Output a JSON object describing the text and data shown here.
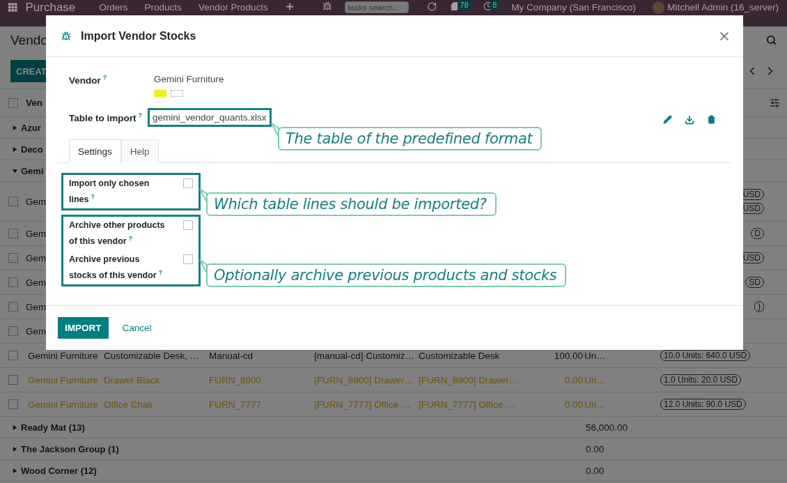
{
  "navbar": {
    "app": "Purchase",
    "menu": [
      "Orders",
      "Products",
      "Vendor Products"
    ],
    "search": {
      "placeholder": "tasks search..."
    },
    "messages_count": "78",
    "activities_count": "8",
    "company": "My Company (San Francisco)",
    "user": "Mitchell Admin (16_server)"
  },
  "control_panel": {
    "title": "Vendo",
    "create_button": "CREAT"
  },
  "list": {
    "header": "Ven",
    "select_all_checked": false,
    "rows": [
      {
        "kind": "group",
        "label": "Azur",
        "expanded": false
      },
      {
        "kind": "group",
        "label": "Deco",
        "expanded": false
      },
      {
        "kind": "group",
        "label": "Gemi",
        "expanded": true
      },
      {
        "kind": "clipped",
        "checked": false,
        "cells": [
          "Gem"
        ],
        "badges": [
          "USD",
          "USD"
        ]
      },
      {
        "kind": "clipped",
        "checked": false,
        "cells": [
          "Gem"
        ],
        "badges": [
          "D"
        ]
      },
      {
        "kind": "clipped",
        "checked": false,
        "cells": [
          "Gem"
        ],
        "badges": [
          "USD"
        ]
      },
      {
        "kind": "clipped",
        "checked": false,
        "cells": [
          "Gem"
        ],
        "badges": [
          "SD"
        ]
      },
      {
        "kind": "clipped",
        "checked": false,
        "cells": [
          "Gem"
        ],
        "badges": [
          ")"
        ]
      },
      {
        "kind": "clipped",
        "checked": false,
        "cells": [
          "Gem"
        ],
        "badges": []
      },
      {
        "kind": "record",
        "checked": false,
        "warning": false,
        "cells": [
          "Gemini Furniture",
          "Customizable Desk, …",
          "Manual-cd",
          "[manual-cd] Customiz…",
          "Customizable Desk",
          "100.00",
          "Un…"
        ],
        "badges": [
          "10.0 Units: 640.0 USD"
        ]
      },
      {
        "kind": "record",
        "checked": false,
        "warning": true,
        "cells": [
          "Gemini Furniture",
          "Drawer Black",
          "FURN_8900",
          "[FURN_8900] Drawer…",
          "[FURN_8900] Drawer…",
          "0.00",
          "Un…"
        ],
        "badges": [
          "1.0 Units: 20.0 USD"
        ]
      },
      {
        "kind": "record",
        "checked": false,
        "warning": true,
        "cells": [
          "Gemini Furniture",
          "Office Chair",
          "FURN_7777",
          "[FURN_7777] Office …",
          "[FURN_7777] Office …",
          "0.00",
          "Un…"
        ],
        "badges": [
          "12.0 Units: 90.0 USD"
        ]
      },
      {
        "kind": "group",
        "label": "Ready Mat (13)",
        "expanded": false,
        "total": "56,000.00"
      },
      {
        "kind": "group",
        "label": "The Jackson Group (1)",
        "expanded": false,
        "total": "0.00"
      },
      {
        "kind": "group",
        "label": "Wood Corner (12)",
        "expanded": false,
        "total": "0.00"
      }
    ]
  },
  "dialog": {
    "title": "Import Vendor Stocks",
    "vendor": {
      "label": "Vendor",
      "help": "?",
      "value": "Gemini Furniture",
      "tags": [
        {
          "color": "#f0f020"
        },
        {
          "color": "#ffffff"
        }
      ]
    },
    "table": {
      "label": "Table to import",
      "help": "?",
      "value": "gemini_vendor_quants.xlsx"
    },
    "tabs": [
      {
        "label": "Settings",
        "selected": true
      },
      {
        "label": "Help",
        "selected": false
      }
    ],
    "option_groups": [
      [
        {
          "label": "Import only chosen lines",
          "help": "?",
          "checked": false
        }
      ],
      [
        {
          "label": "Archive other products of this vendor",
          "help": "?",
          "checked": false
        },
        {
          "label": "Archive previous stocks of this vendor",
          "help": "?",
          "checked": false
        }
      ]
    ],
    "buttons": {
      "primary": "IMPORT",
      "secondary": "Cancel"
    }
  },
  "callouts": [
    "The table of the predefined format",
    "Which table lines should be imported?",
    "Optionally archive previous products and stocks"
  ]
}
